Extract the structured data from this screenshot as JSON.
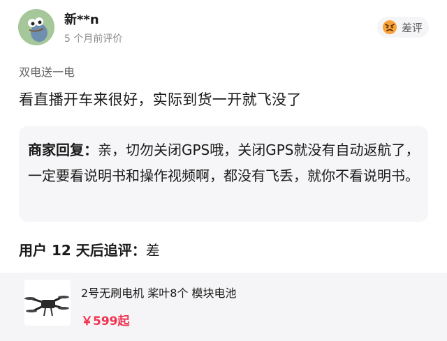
{
  "review": {
    "username": "新**n",
    "time": "5 个月前评价",
    "rating_label": "差评",
    "rating_icon": "angry-face-icon",
    "sku": "双电送一电",
    "text": "看直播开车来很好，实际到货一开就飞没了"
  },
  "merchant_reply": {
    "label": "商家回复：",
    "text": "亲，切勿关闭GPS哦，关闭GPS就没有自动返航了，一定要看说明书和操作视频啊，都没有飞丢，就你不看说明书。"
  },
  "followup": {
    "label": "用户 12 天后追评：",
    "text": "差"
  },
  "product": {
    "name": "2号无刷电机 桨叶8个 模块电池",
    "price": "￥599起",
    "price_color": "#f0324f"
  }
}
